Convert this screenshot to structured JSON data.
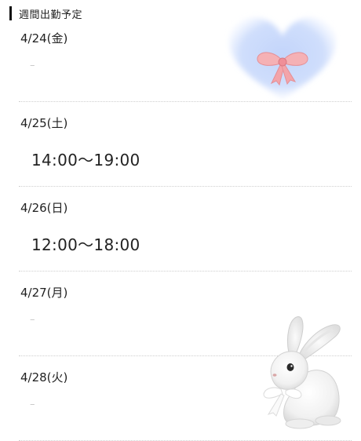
{
  "header": {
    "title": "週間出勤予定"
  },
  "schedule": [
    {
      "date": "4/24(金)",
      "time": "–"
    },
    {
      "date": "4/25(土)",
      "time": "14:00〜19:00"
    },
    {
      "date": "4/26(日)",
      "time": "12:00〜18:00"
    },
    {
      "date": "4/27(月)",
      "time": "–"
    },
    {
      "date": "4/28(火)",
      "time": "–"
    }
  ],
  "decorations": {
    "heart_icon": "heart-with-ribbon-bow",
    "rabbit_icon": "white-rabbit-figurine"
  },
  "colors": {
    "heart": "#c9dafc",
    "bow": "#f3a9ae",
    "divider": "#cfcfcf",
    "off_dash": "#c8c8c8",
    "accent_bar": "#111111"
  }
}
